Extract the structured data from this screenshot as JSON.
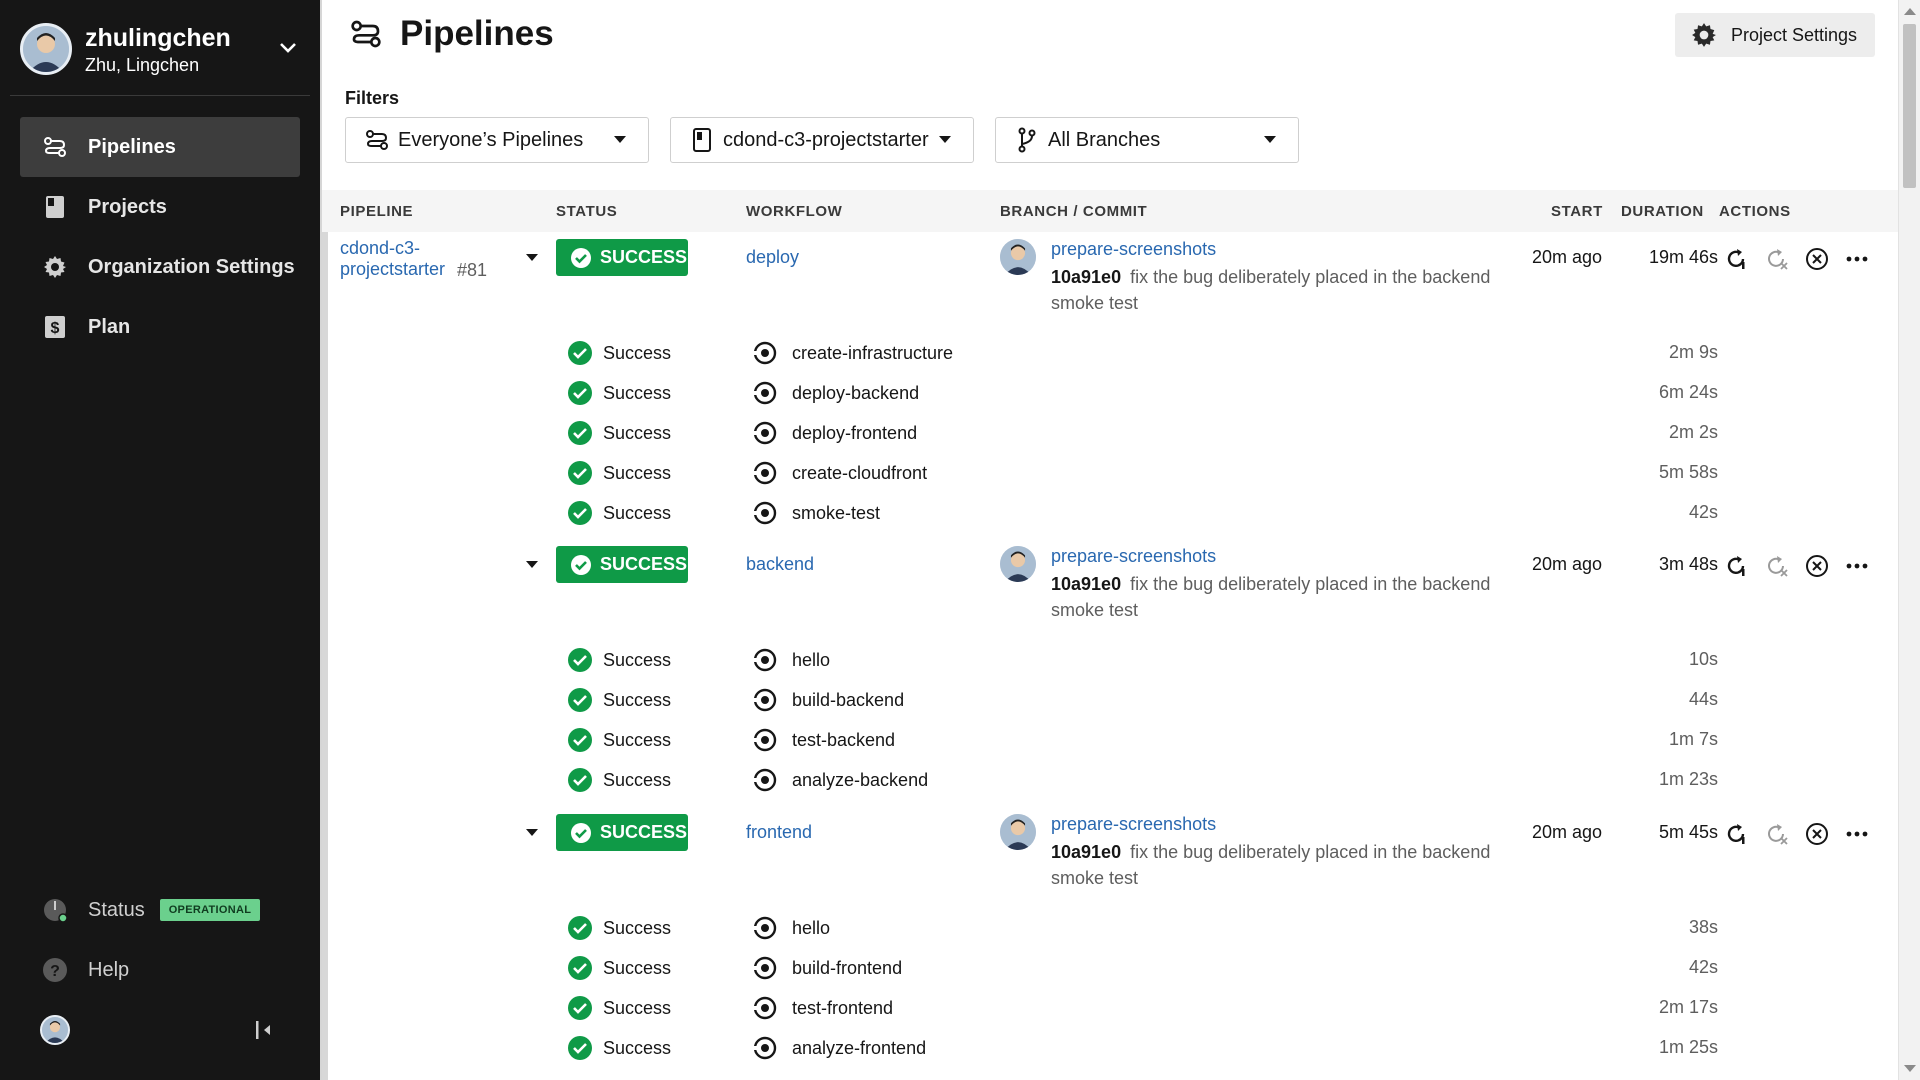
{
  "sidebar": {
    "username": "zhulingchen",
    "full_name": "Zhu, Lingchen",
    "nav": [
      {
        "label": "Pipelines",
        "icon": "pipelines-icon",
        "active": true
      },
      {
        "label": "Projects",
        "icon": "projects-icon",
        "active": false
      },
      {
        "label": "Organization Settings",
        "icon": "gear-icon",
        "active": false
      },
      {
        "label": "Plan",
        "icon": "dollar-icon",
        "active": false
      }
    ],
    "status_label": "Status",
    "status_badge": "OPERATIONAL",
    "help_label": "Help"
  },
  "header": {
    "title": "Pipelines",
    "project_settings": "Project Settings",
    "filters_label": "Filters",
    "filters": {
      "pipelines": "Everyone’s Pipelines",
      "project": "cdond-c3-projectstarter",
      "branches": "All Branches"
    }
  },
  "table": {
    "headers": {
      "pipeline": "PIPELINE",
      "status": "STATUS",
      "workflow": "WORKFLOW",
      "branch_commit": "BRANCH / COMMIT",
      "start": "START",
      "duration": "DURATION",
      "actions": "ACTIONS"
    },
    "pipeline": {
      "name": "cdond-c3-projectstarter",
      "number": "#81"
    },
    "workflows": [
      {
        "status": "SUCCESS",
        "name": "deploy",
        "branch": "prepare-screenshots",
        "sha": "10a91e0",
        "message": "fix the bug deliberately placed in the backend smoke test",
        "start": "20m ago",
        "duration": "19m 46s",
        "jobs": [
          {
            "status": "Success",
            "name": "create-infrastructure",
            "duration": "2m 9s"
          },
          {
            "status": "Success",
            "name": "deploy-backend",
            "duration": "6m 24s"
          },
          {
            "status": "Success",
            "name": "deploy-frontend",
            "duration": "2m 2s"
          },
          {
            "status": "Success",
            "name": "create-cloudfront",
            "duration": "5m 58s"
          },
          {
            "status": "Success",
            "name": "smoke-test",
            "duration": "42s"
          }
        ]
      },
      {
        "status": "SUCCESS",
        "name": "backend",
        "branch": "prepare-screenshots",
        "sha": "10a91e0",
        "message": "fix the bug deliberately placed in the backend smoke test",
        "start": "20m ago",
        "duration": "3m 48s",
        "jobs": [
          {
            "status": "Success",
            "name": "hello",
            "duration": "10s"
          },
          {
            "status": "Success",
            "name": "build-backend",
            "duration": "44s"
          },
          {
            "status": "Success",
            "name": "test-backend",
            "duration": "1m 7s"
          },
          {
            "status": "Success",
            "name": "analyze-backend",
            "duration": "1m 23s"
          }
        ]
      },
      {
        "status": "SUCCESS",
        "name": "frontend",
        "branch": "prepare-screenshots",
        "sha": "10a91e0",
        "message": "fix the bug deliberately placed in the backend smoke test",
        "start": "20m ago",
        "duration": "5m 45s",
        "jobs": [
          {
            "status": "Success",
            "name": "hello",
            "duration": "38s"
          },
          {
            "status": "Success",
            "name": "build-frontend",
            "duration": "42s"
          },
          {
            "status": "Success",
            "name": "test-frontend",
            "duration": "2m 17s"
          },
          {
            "status": "Success",
            "name": "analyze-frontend",
            "duration": "1m 25s"
          }
        ]
      }
    ]
  },
  "colors": {
    "sidebar_bg": "#161616",
    "success": "#0f9a47",
    "link": "#2968b0",
    "operational": "#6bd08d"
  }
}
